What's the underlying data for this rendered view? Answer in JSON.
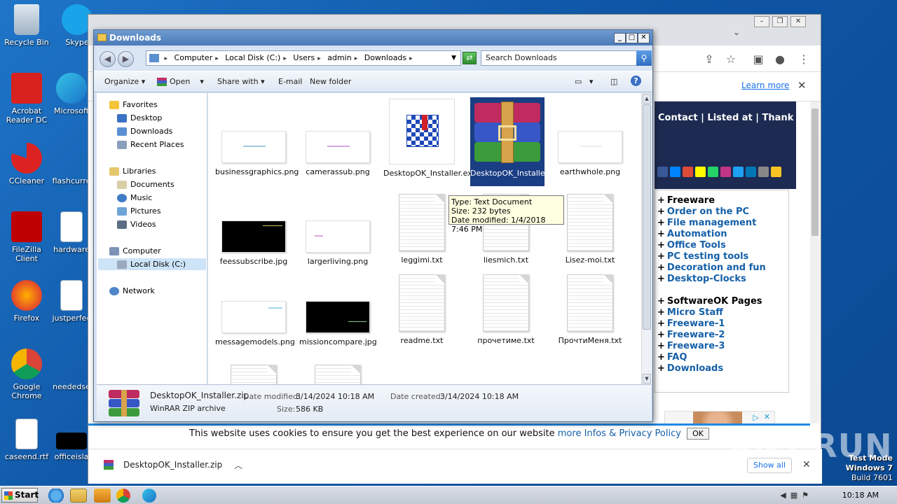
{
  "desktop": {
    "icons": [
      {
        "label": "Recycle Bin"
      },
      {
        "label": "Skype"
      },
      {
        "label": "Acrobat Reader DC"
      },
      {
        "label": "Microsoft"
      },
      {
        "label": "CCleaner"
      },
      {
        "label": "flashcurre"
      },
      {
        "label": "FileZilla Client"
      },
      {
        "label": "hardware"
      },
      {
        "label": "Firefox"
      },
      {
        "label": "justperfec"
      },
      {
        "label": "Google Chrome"
      },
      {
        "label": "neededse"
      },
      {
        "label": "caseend.rtf"
      },
      {
        "label": "officeisla"
      }
    ],
    "test_mode": {
      "line1": "Test Mode",
      "line2": "Windows 7",
      "line3": "Build 7601"
    },
    "watermark": "ANY.RUN"
  },
  "browser": {
    "infobar_link": "Learn more",
    "site_nav_text": "Contact | Listed at | Thank you",
    "menu": {
      "sections": [
        {
          "header": "Freeware",
          "links": [
            "Order on the PC",
            "File management",
            "Automation",
            "Office Tools",
            "PC testing tools",
            "Decoration and fun",
            "Desktop-Clocks"
          ]
        },
        {
          "header": "SoftwareOK Pages",
          "links": [
            "Micro Staff",
            "Freeware-1",
            "Freeware-2",
            "Freeware-3",
            "FAQ",
            "Downloads"
          ]
        }
      ],
      "plus": "+"
    },
    "cookie": {
      "text": "This website uses cookies to ensure you get the best experience on our website",
      "link": "more Infos & Privacy Policy",
      "ok": "OK"
    },
    "download_bar": {
      "file": "DesktopOK_Installer.zip",
      "show_all": "Show all",
      "close": "✕"
    }
  },
  "explorer": {
    "title": "Downloads",
    "title_buttons": {
      "min": "_",
      "max": "□",
      "close": "✕"
    },
    "breadcrumbs": [
      "Computer",
      "Local Disk (C:)",
      "Users",
      "admin",
      "Downloads"
    ],
    "search_placeholder": "Search Downloads",
    "commands": {
      "organize": "Organize",
      "open": "Open",
      "share": "Share with",
      "email": "E-mail",
      "new_folder": "New folder"
    },
    "nav": {
      "favorites": "Favorites",
      "desktop": "Desktop",
      "downloads": "Downloads",
      "recent": "Recent Places",
      "libraries": "Libraries",
      "documents": "Documents",
      "music": "Music",
      "pictures": "Pictures",
      "videos": "Videos",
      "computer": "Computer",
      "localdisk": "Local Disk (C:)",
      "network": "Network"
    },
    "files": [
      {
        "name": "businessgraphics.png",
        "kind": "image"
      },
      {
        "name": "camerassub.png",
        "kind": "image"
      },
      {
        "name": "DesktopOK_Installer.exe",
        "kind": "exe"
      },
      {
        "name": "DesktopOK_Installer.zip",
        "kind": "zip",
        "selected": true
      },
      {
        "name": "earthwhole.png",
        "kind": "image"
      },
      {
        "name": "feessubscribe.jpg",
        "kind": "image-dark"
      },
      {
        "name": "largerliving.png",
        "kind": "image"
      },
      {
        "name": "leggimi.txt",
        "kind": "text"
      },
      {
        "name": "liesmich.txt",
        "kind": "text"
      },
      {
        "name": "Lisez-moi.txt",
        "kind": "text"
      },
      {
        "name": "messagemodels.png",
        "kind": "image"
      },
      {
        "name": "missioncompare.jpg",
        "kind": "image-dark"
      },
      {
        "name": "readme.txt",
        "kind": "text"
      },
      {
        "name": "прочетиме.txt",
        "kind": "text"
      },
      {
        "name": "ПрочтиМеня.txt",
        "kind": "text"
      }
    ],
    "tooltip": {
      "type": "Type: Text Document",
      "size": "Size: 232 bytes",
      "modified": "Date modified: 1/4/2018 7:46 PM"
    },
    "details": {
      "name": "DesktopOK_Installer.zip",
      "type": "WinRAR ZIP archive",
      "modified_label": "Date modified:",
      "modified": "3/14/2024 10:18 AM",
      "size_label": "Size:",
      "size": "586 KB",
      "created_label": "Date created:",
      "created": "3/14/2024 10:18 AM"
    }
  },
  "taskbar": {
    "start": "Start",
    "clock": "10:18 AM"
  }
}
